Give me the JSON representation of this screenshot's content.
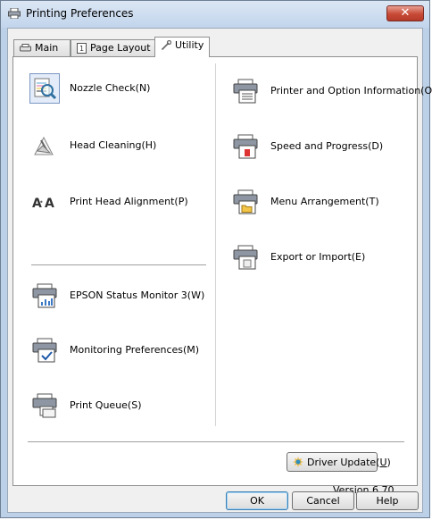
{
  "window": {
    "title": "Printing Preferences",
    "close_label": "✕"
  },
  "tabs": [
    {
      "label": "Main",
      "icon": "printer-icon"
    },
    {
      "label": "Page Layout",
      "icon": "page-layout-icon"
    },
    {
      "label": "Utility",
      "icon": "wrench-icon",
      "active": true
    }
  ],
  "utilities_left": [
    {
      "label": "Nozzle Check(N)",
      "icon": "nozzle-check-icon",
      "selected": true
    },
    {
      "label": "Head Cleaning(H)",
      "icon": "head-cleaning-icon"
    },
    {
      "label": "Print Head Alignment(P)",
      "icon": "print-head-alignment-icon"
    },
    {
      "label": "EPSON Status Monitor 3(W)",
      "icon": "status-monitor-icon"
    },
    {
      "label": "Monitoring Preferences(M)",
      "icon": "monitoring-preferences-icon"
    },
    {
      "label": "Print Queue(S)",
      "icon": "print-queue-icon"
    }
  ],
  "utilities_right": [
    {
      "label": "Printer and Option Information(O)",
      "icon": "printer-info-icon"
    },
    {
      "label": "Speed and Progress(D)",
      "icon": "speed-progress-icon"
    },
    {
      "label": "Menu Arrangement(T)",
      "icon": "menu-arrangement-icon"
    },
    {
      "label": "Export or Import(E)",
      "icon": "export-import-icon"
    }
  ],
  "driver_update": {
    "label_prefix": "Driver Update(",
    "accel": "U",
    "label_suffix": ")",
    "icon": "update-icon"
  },
  "version": "Version 6.70",
  "buttons": {
    "ok": "OK",
    "cancel": "Cancel",
    "help": "Help"
  },
  "colors": {
    "title_bar": "#c2d5ec",
    "close_button": "#c74a36",
    "selection": "#e3ecf8"
  }
}
